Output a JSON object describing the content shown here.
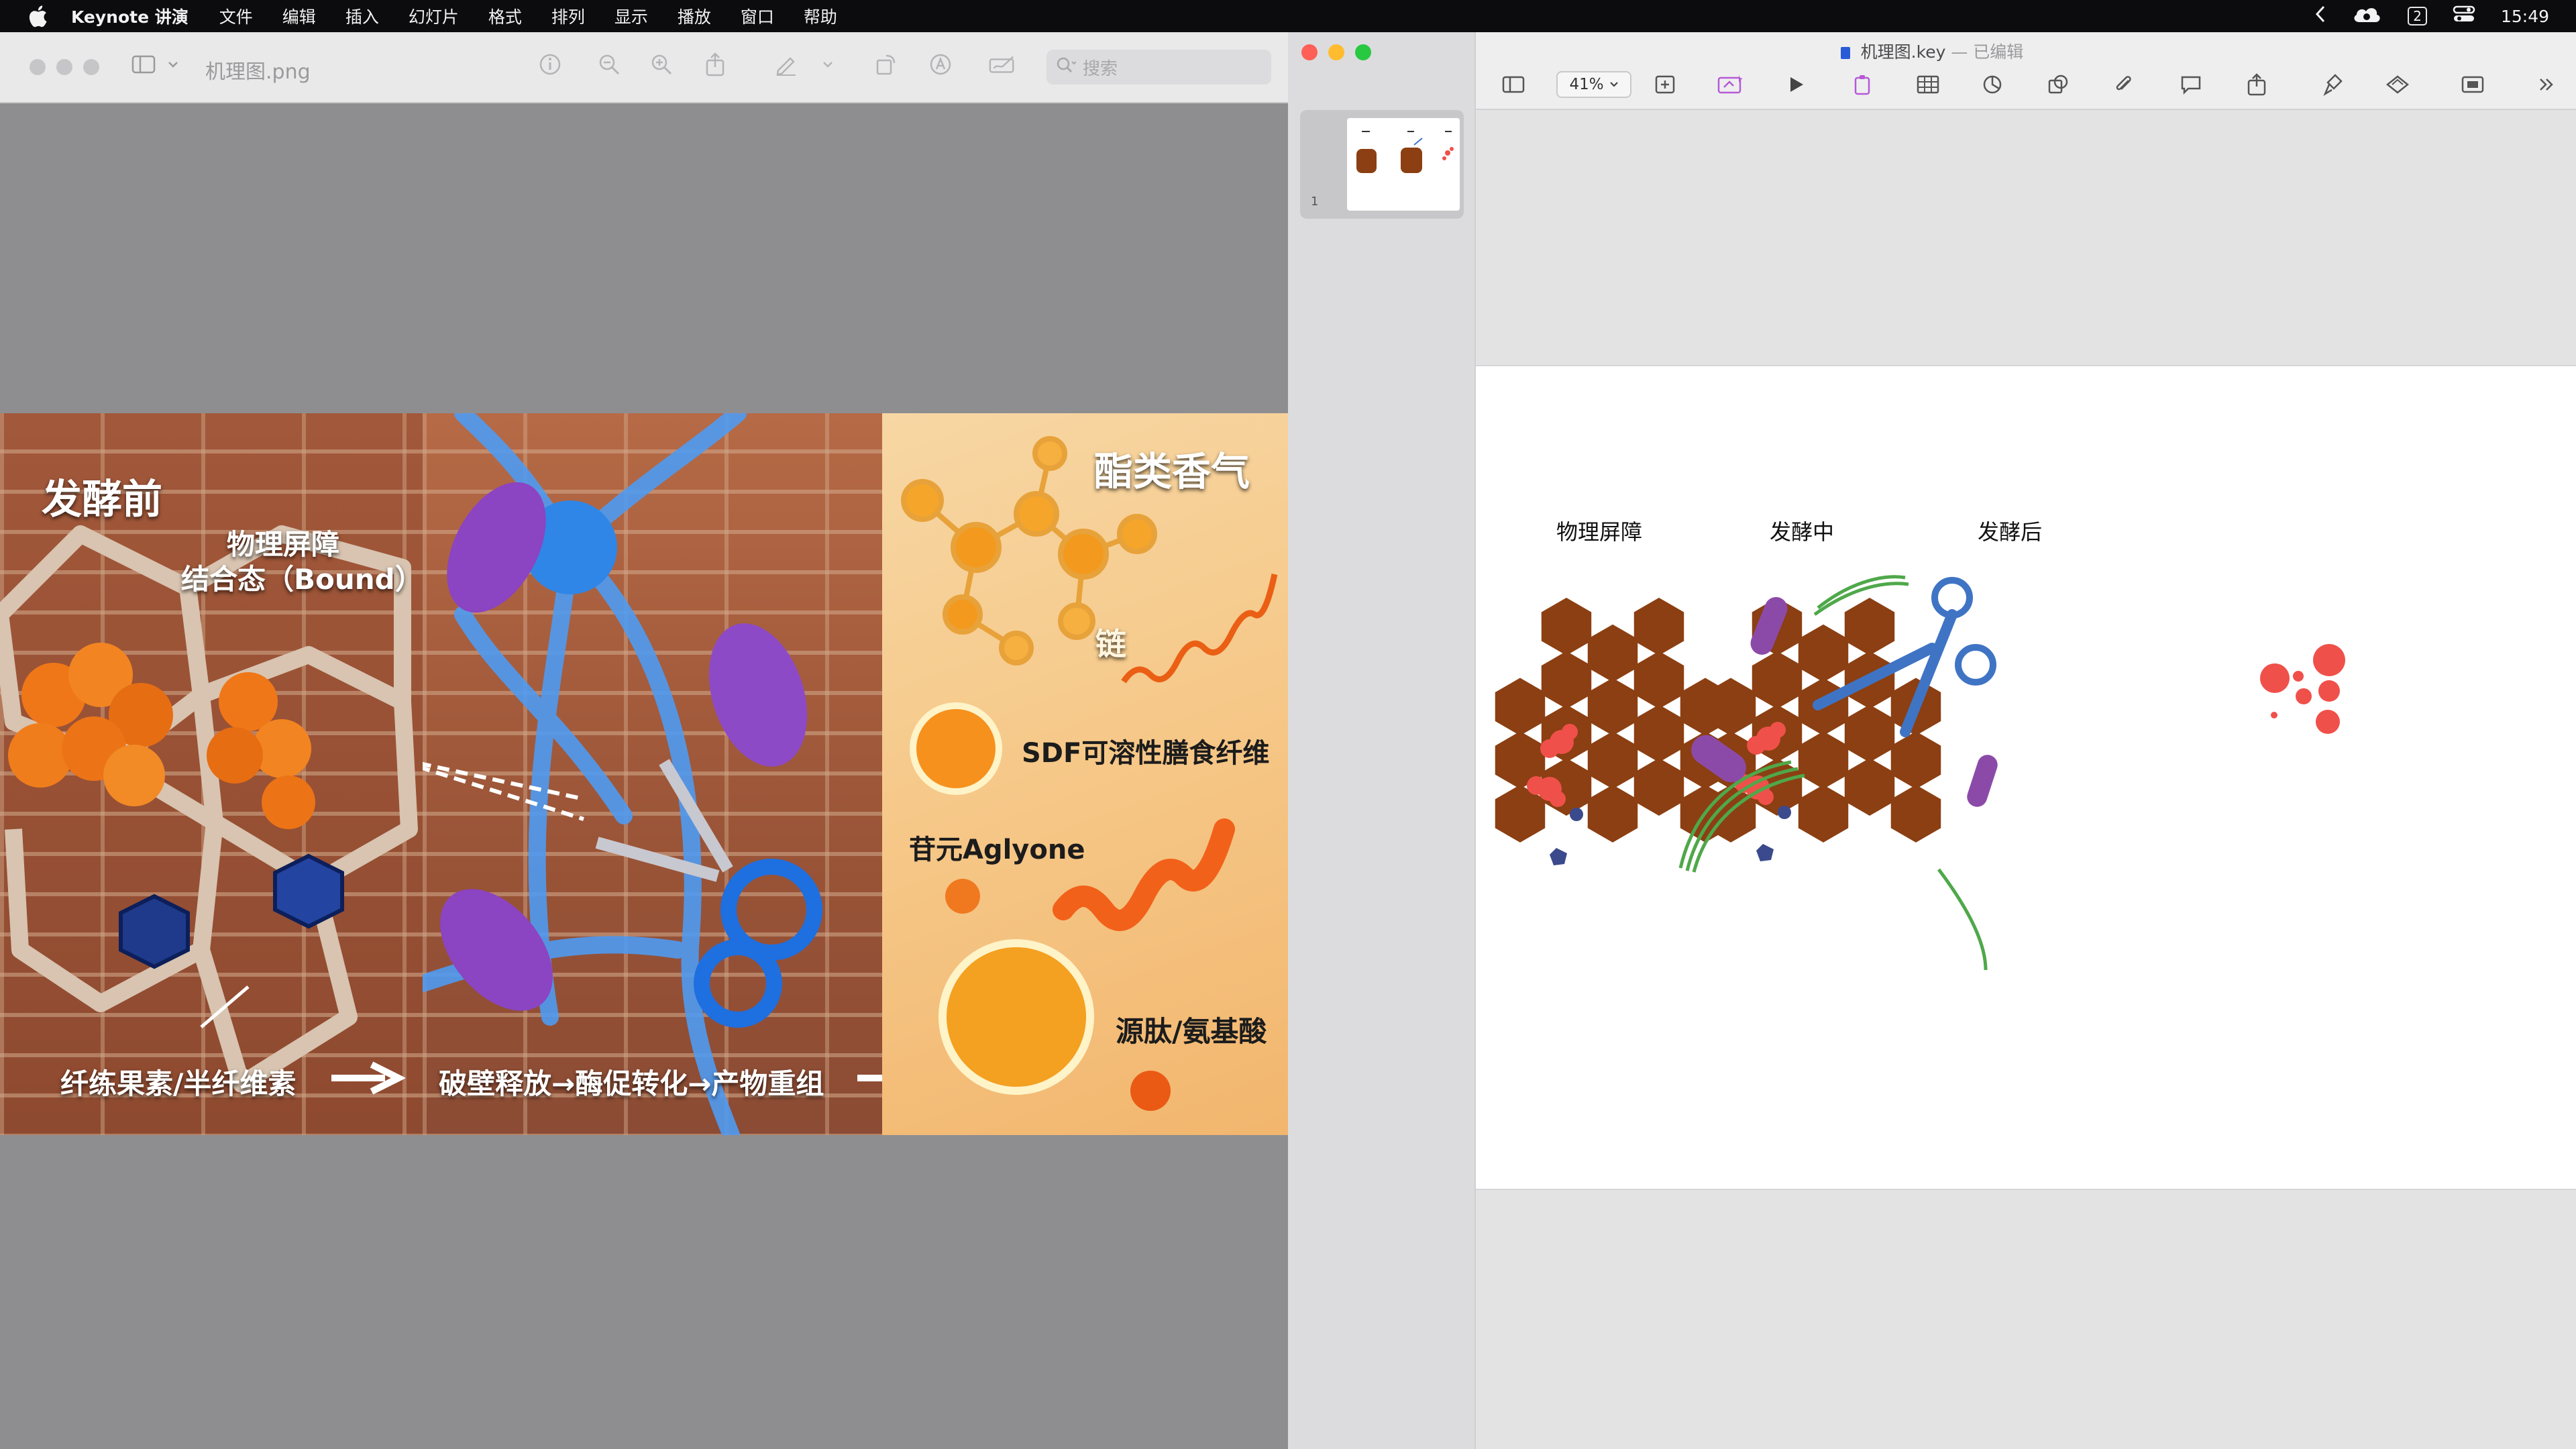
{
  "menubar": {
    "app_name": "Keynote 讲演",
    "items": [
      "文件",
      "编辑",
      "插入",
      "幻灯片",
      "格式",
      "排列",
      "显示",
      "播放",
      "窗口",
      "帮助"
    ],
    "desktop_number": "2",
    "time": "15:49"
  },
  "preview": {
    "title": "机理图.png",
    "search_placeholder": "搜索",
    "illustration": {
      "panel1_heading": "发酵前",
      "barrier_label_1": "物理屏障",
      "barrier_label_2": "结合态（Bound）",
      "bottom_left": "纤练果素/半纤维素",
      "bottom_mid": "破壁释放→酶促转化→产物重组",
      "panel3_heading": "酯类香气",
      "sdf_label": "SDF可溶性膳食纤维",
      "aglycone_label": "苷元Aglyone",
      "peptide_label": "源肽/氨基酸",
      "molecule_char": "链"
    }
  },
  "keynote": {
    "window_title": "机理图.key",
    "edited_label": "已编辑",
    "zoom": "41%",
    "slide_number": "1",
    "slide": {
      "label_left": "物理屏障",
      "label_mid": "发酵中",
      "label_right": "发酵后"
    }
  },
  "colors": {
    "hex_fill": "#8b3f12",
    "red_dot": "#f0504a",
    "blue_dot": "#3b4a8c",
    "scissor_blue": "#3f74c4",
    "purple": "#8c4aa8",
    "green": "#4fa84a"
  }
}
